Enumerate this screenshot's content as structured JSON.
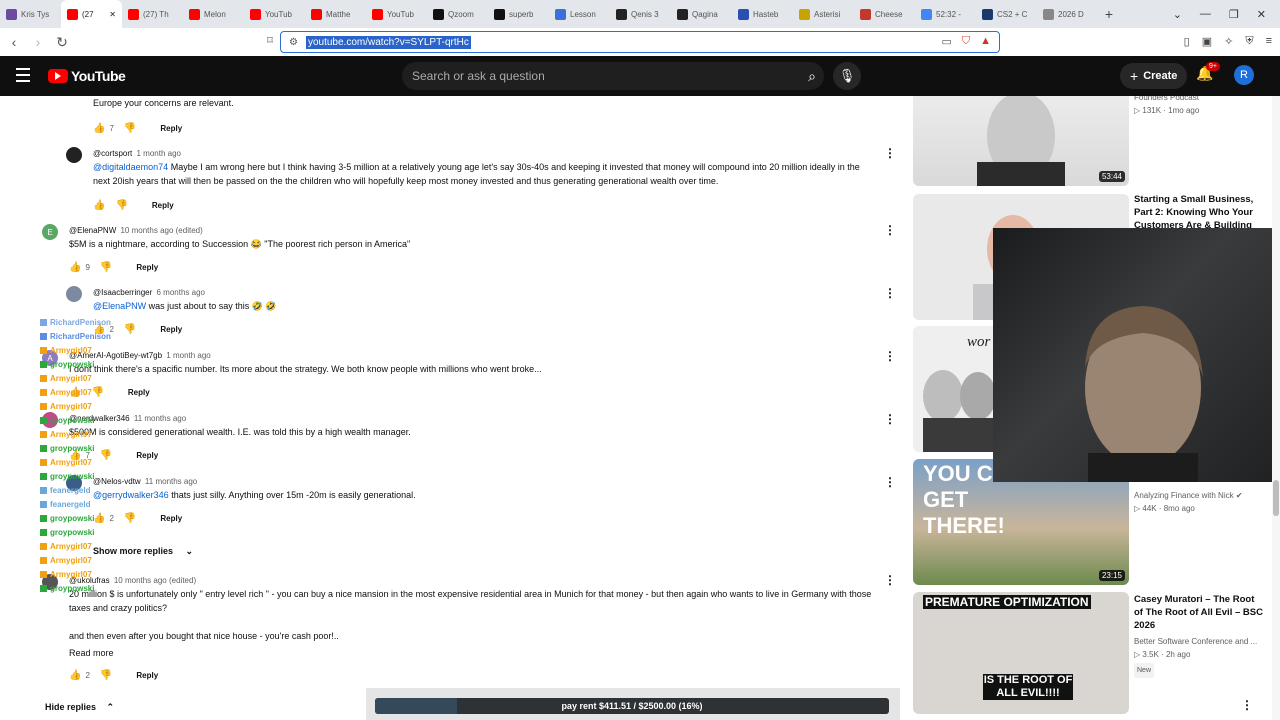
{
  "browser": {
    "tabs": [
      {
        "label": "Kris Tys",
        "color": "#6b4aa0"
      },
      {
        "label": "(27",
        "color": "#ff0000",
        "active": true
      },
      {
        "label": "(27) Th",
        "color": "#ff0000"
      },
      {
        "label": "Melon",
        "color": "#ff0000"
      },
      {
        "label": "YouTub",
        "color": "#ff0000"
      },
      {
        "label": "Matthe",
        "color": "#ff0000"
      },
      {
        "label": "YouTub",
        "color": "#ff0000"
      },
      {
        "label": "Qzoom",
        "color": "#111111"
      },
      {
        "label": "superb",
        "color": "#111111"
      },
      {
        "label": "Lesson",
        "color": "#3b6fd9"
      },
      {
        "label": "Qenis 3",
        "color": "#222222"
      },
      {
        "label": "Qagina",
        "color": "#222222"
      },
      {
        "label": "Hasteb",
        "color": "#2a4fb0"
      },
      {
        "label": "Asterisi",
        "color": "#c9a400"
      },
      {
        "label": "Cheese",
        "color": "#c0392b"
      },
      {
        "label": "52:32 -",
        "color": "#4285f4"
      },
      {
        "label": "CS2 + C",
        "color": "#1b3a6b"
      },
      {
        "label": "2026 D",
        "color": "#888888"
      }
    ],
    "new_tab": "+",
    "url": "youtube.com/watch?v=SYLPT-qrtHc"
  },
  "header": {
    "logo_text": "YouTube",
    "search_placeholder": "Search or ask a question",
    "create_label": "Create",
    "notif_badge": "9+",
    "avatar_letter": "R"
  },
  "comments": [
    {
      "text": "Europe your concerns are relevant.",
      "likes": "7",
      "reply": "Reply"
    },
    {
      "avatar_letter": "",
      "author": "@cortsport",
      "time": "1 month ago",
      "mention": "@digitaldaemon74",
      "text1": "Maybe I am wrong here but I think having 3-5 million at a relatively young age let's say 30s-40s and keeping it invested that money will compound into 20 million ideally in the",
      "text2": "next 20ish years that will then be passed on the the children who will hopefully keep most money invested and thus generating generational wealth over time.",
      "reply": "Reply"
    },
    {
      "avatar_letter": "E",
      "author": "@ElenaPNW",
      "time": "10 months ago (edited)",
      "text": "$5M is a nightmare, according to Succession 😂 \"The poorest rich person in America\"",
      "likes": "9",
      "reply": "Reply"
    },
    {
      "avatar_letter": "",
      "author": "@Isaacberringer",
      "time": "6 months ago",
      "mention": "@ElenaPNW",
      "text": "was just about to say this 🤣 🤣",
      "likes": "2",
      "reply": "Reply"
    },
    {
      "avatar_letter": "A",
      "author": "@AmerAl-AgotiBey-wt7gb",
      "time": "1 month ago",
      "text": "I dont think there's a spacific number. Its more about the strategy. We both know people with millions who went broke...",
      "reply": "Reply"
    },
    {
      "avatar_letter": "",
      "author": "@nerdwalker346",
      "time": "11 months ago",
      "text": "$500M is considered generational wealth. I.E. was told this by a high wealth manager.",
      "likes": "7",
      "reply": "Reply"
    },
    {
      "avatar_letter": "",
      "author": "@Nelos-vdtw",
      "time": "11 months ago",
      "mention": "@gerrydwalker346",
      "text": "thats just silly.  Anything over 15m -20m is easily generational.",
      "likes": "2",
      "reply": "Reply"
    },
    {
      "avatar_letter": "",
      "author": "@ukolufras",
      "time": "10 months ago (edited)",
      "text1": "20 million $ is unfortunately only \" entry level rich \" - you can buy a nice mansion in the most expensive residential area in Munich for that money - but then again who wants to live in Germany with those",
      "text2": "taxes and crazy politics?",
      "text3": "and then even after you bought that nice house - you're cash poor!..",
      "likes": "2",
      "reply": "Reply"
    }
  ],
  "show_more_replies": "Show more replies",
  "read_more": "Read more",
  "hide_replies": "Hide replies",
  "chat": [
    {
      "name": "RichardPenison",
      "color": "#7ea6e0"
    },
    {
      "name": "RichardPenison",
      "color": "#5b8de0"
    },
    {
      "name": "Armygirl07",
      "color": "#f0a010"
    },
    {
      "name": "groypowski",
      "color": "#2aa83a"
    },
    {
      "name": "Armygirl07",
      "color": "#f0a010"
    },
    {
      "name": "Armygirl07",
      "color": "#f0a010"
    },
    {
      "name": "Armygirl07",
      "color": "#f0a010"
    },
    {
      "name": "groypowski",
      "color": "#2aa83a"
    },
    {
      "name": "Armygirl07",
      "color": "#f0a010"
    },
    {
      "name": "groypowski",
      "color": "#2aa83a"
    },
    {
      "name": "Armygirl07",
      "color": "#f0a010"
    },
    {
      "name": "groypowski",
      "color": "#2aa83a"
    },
    {
      "name": "feanergeld",
      "color": "#6aa7d8"
    },
    {
      "name": "feanergeld",
      "color": "#6aa7d8"
    },
    {
      "name": "groypowski",
      "color": "#2aa83a"
    },
    {
      "name": "groypowski",
      "color": "#2aa83a"
    },
    {
      "name": "Armygirl07",
      "color": "#f0a010"
    },
    {
      "name": "Armygirl07",
      "color": "#f0a010"
    },
    {
      "name": "Armygirl07",
      "color": "#f0a010"
    },
    {
      "name": "groypowski",
      "color": "#2aa83a"
    }
  ],
  "sidebar": [
    {
      "title": "",
      "meta1": "Founders Podcast",
      "meta2": "▷ 131K · 1mo ago",
      "duration": "53:44"
    },
    {
      "title": "Starting a Small Business, Part 2: Knowing Who Your Customers Are & Building",
      "meta1": "",
      "meta2": "",
      "duration": ""
    },
    {
      "title": "",
      "meta1": "",
      "meta2": "",
      "duration": "",
      "thumb_text": "wor"
    },
    {
      "title": "",
      "meta1": "Analyzing Finance with Nick ✔",
      "meta2": "▷ 44K · 8mo ago",
      "duration": "23:15",
      "thumb_text": "YOU C GET THERE!"
    },
    {
      "title": "Casey Muratori – The Root of The Root of All Evil – BSC 2026",
      "meta1": "Better Software Conference and ...",
      "meta2": "▷ 3.5K · 2h ago",
      "new": "New",
      "thumb_top": "PREMATURE OPTIMIZATION",
      "thumb_bottom": "IS THE ROOT OF ALL EVIL!!!!"
    }
  ],
  "rent": {
    "label": "pay rent $411.51 / $2500.00 (16%)",
    "progress": 0.16
  }
}
